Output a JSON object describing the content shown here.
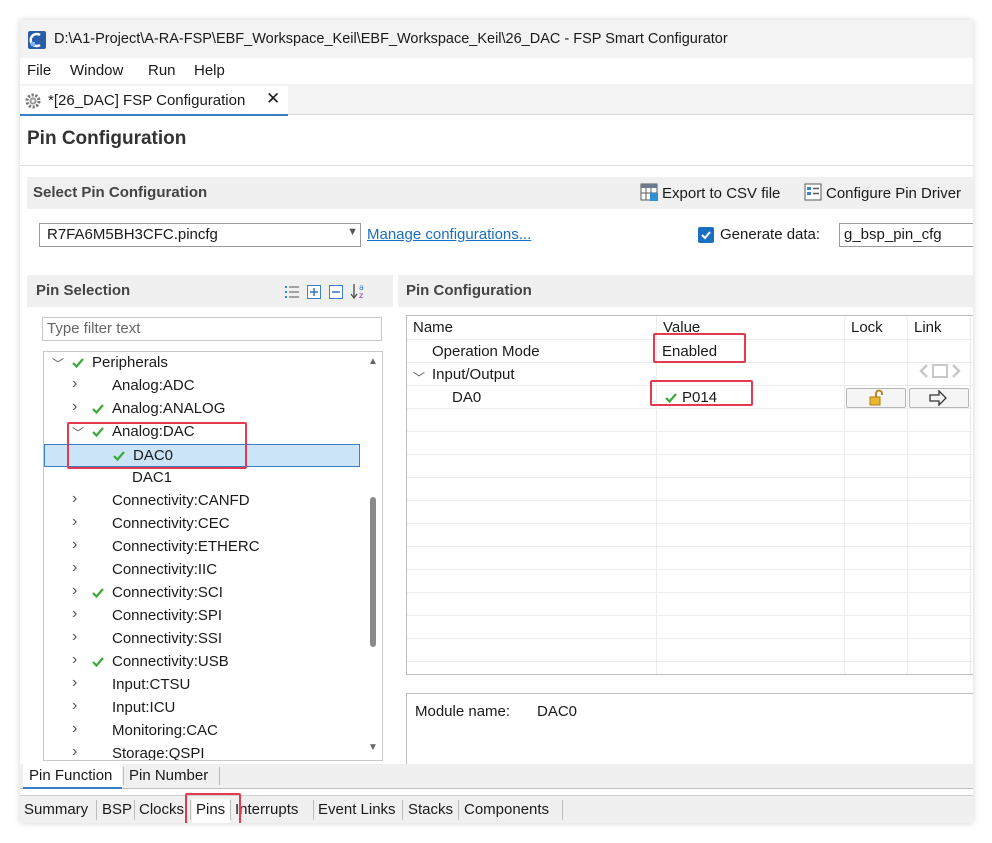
{
  "window": {
    "title": "D:\\A1-Project\\A-RA-FSP\\EBF_Workspace_Keil\\EBF_Workspace_Keil\\26_DAC - FSP Smart Configurator"
  },
  "menu": [
    "File",
    "Window",
    "Run",
    "Help"
  ],
  "editor_tab": {
    "label": "*[26_DAC] FSP Configuration",
    "close": "✕"
  },
  "page_title": "Pin Configuration",
  "select_pin_config": {
    "title": "Select Pin Configuration",
    "export_label": "Export to CSV file",
    "configure_label": "Configure Pin Driver",
    "combo_value": "R7FA6M5BH3CFC.pincfg",
    "manage_link": "Manage configurations...",
    "generate_checked": true,
    "generate_label": "Generate data:",
    "generate_value": "g_bsp_pin_cfg"
  },
  "pin_selection": {
    "title": "Pin Selection",
    "filter_placeholder": "Type filter text",
    "tree": [
      {
        "label": "Peripherals",
        "level": 0,
        "expanded": true,
        "check": true
      },
      {
        "label": "Analog:ADC",
        "level": 1,
        "expanded": false,
        "check": false
      },
      {
        "label": "Analog:ANALOG",
        "level": 1,
        "expanded": false,
        "check": true
      },
      {
        "label": "Analog:DAC",
        "level": 1,
        "expanded": true,
        "check": true
      },
      {
        "label": "DAC0",
        "level": 2,
        "check": true,
        "selected": true
      },
      {
        "label": "DAC1",
        "level": 2,
        "check": false
      },
      {
        "label": "Connectivity:CANFD",
        "level": 1,
        "expanded": false,
        "check": false
      },
      {
        "label": "Connectivity:CEC",
        "level": 1,
        "expanded": false,
        "check": false
      },
      {
        "label": "Connectivity:ETHERC",
        "level": 1,
        "expanded": false,
        "check": false
      },
      {
        "label": "Connectivity:IIC",
        "level": 1,
        "expanded": false,
        "check": false
      },
      {
        "label": "Connectivity:SCI",
        "level": 1,
        "expanded": false,
        "check": true
      },
      {
        "label": "Connectivity:SPI",
        "level": 1,
        "expanded": false,
        "check": false
      },
      {
        "label": "Connectivity:SSI",
        "level": 1,
        "expanded": false,
        "check": false
      },
      {
        "label": "Connectivity:USB",
        "level": 1,
        "expanded": false,
        "check": true
      },
      {
        "label": "Input:CTSU",
        "level": 1,
        "expanded": false,
        "check": false
      },
      {
        "label": "Input:ICU",
        "level": 1,
        "expanded": false,
        "check": false
      },
      {
        "label": "Monitoring:CAC",
        "level": 1,
        "expanded": false,
        "check": false
      },
      {
        "label": "Storage:QSPI",
        "level": 1,
        "expanded": false,
        "check": false
      }
    ]
  },
  "pin_configuration": {
    "title": "Pin Configuration",
    "columns": {
      "name": "Name",
      "value": "Value",
      "lock": "Lock",
      "link": "Link"
    },
    "operation_mode_name": "Operation Mode",
    "operation_mode_value": "Enabled",
    "group_name": "Input/Output",
    "da0_name": "DA0",
    "da0_value": "P014",
    "module_label": "Module name:",
    "module_value": "DAC0"
  },
  "pin_tabs": [
    "Pin Function",
    "Pin Number"
  ],
  "bottom_tabs": [
    "Summary",
    "BSP",
    "Clocks",
    "Pins",
    "Interrupts",
    "Event Links",
    "Stacks",
    "Components"
  ],
  "active_bottom_tab": "Pins",
  "colors": {
    "accent": "#1a6fc0",
    "check_green": "#3aa83a",
    "highlight_red": "#e53950"
  }
}
